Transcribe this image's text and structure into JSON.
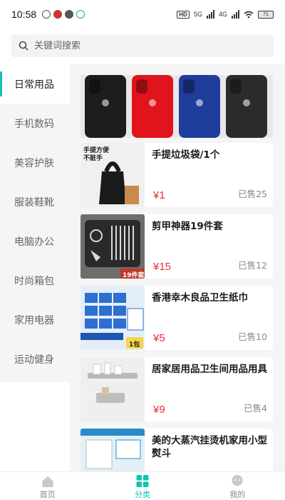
{
  "status_bar": {
    "time": "10:58",
    "network_tag": "HD",
    "net1": "5G",
    "net2": "4G",
    "battery": "71"
  },
  "search": {
    "placeholder": "关键词搜索"
  },
  "sidebar": {
    "items": [
      {
        "label": "日常用品",
        "active": true
      },
      {
        "label": "手机数码",
        "active": false
      },
      {
        "label": "美容护肤",
        "active": false
      },
      {
        "label": "服装鞋靴",
        "active": false
      },
      {
        "label": "电脑办公",
        "active": false
      },
      {
        "label": "时尚箱包",
        "active": false
      },
      {
        "label": "家用电器",
        "active": false
      },
      {
        "label": "运动健身",
        "active": false
      }
    ]
  },
  "products": [
    {
      "title": "手提垃圾袋/1个",
      "price": "¥1",
      "sold": "已售25",
      "thumb_text": "手提方便 不脏手"
    },
    {
      "title": "剪甲神器19件套",
      "price": "¥15",
      "sold": "已售12",
      "thumb_text": "19件套"
    },
    {
      "title": "香港幸木良品卫生纸巾",
      "price": "¥5",
      "sold": "已售10",
      "thumb_text": "1包"
    },
    {
      "title": "居家居用品卫生间用品用具",
      "price": "¥9",
      "sold": "已售4",
      "thumb_text": ""
    },
    {
      "title": "美的大蒸汽挂烫机家用小型熨斗",
      "price": "",
      "sold": "",
      "thumb_text": ""
    }
  ],
  "tabbar": {
    "items": [
      {
        "label": "首页",
        "icon": "home-icon",
        "active": false
      },
      {
        "label": "分类",
        "icon": "category-grid-icon",
        "active": true
      },
      {
        "label": "我的",
        "icon": "profile-icon",
        "active": false
      }
    ]
  },
  "colors": {
    "accent": "#12c3b4",
    "price": "#e9303c"
  }
}
